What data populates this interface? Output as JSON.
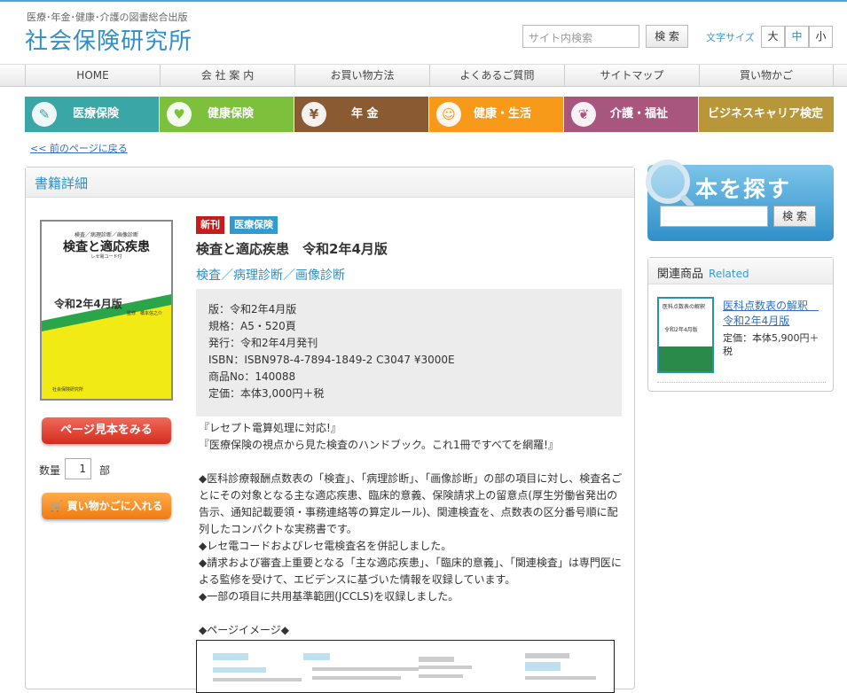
{
  "header": {
    "tagline": "医療･年金･健康･介護の図書総合出版",
    "logo": "社会保険研究所",
    "search_placeholder": "サイト内検索",
    "search_button": "検 索",
    "fontsize_label": "文字サイズ",
    "fontsize_options": [
      "大",
      "中",
      "小"
    ],
    "fontsize_selected": "中"
  },
  "nav": [
    "HOME",
    "会 社 案 内",
    "お買い物方法",
    "よくあるご質問",
    "サイトマップ",
    "買い物かご"
  ],
  "categories": [
    {
      "label": "医療保険",
      "icon": "syringe-icon",
      "glyph": "✎",
      "color": "#3aa6a6"
    },
    {
      "label": "健康保険",
      "icon": "heart-icon",
      "glyph": "♥",
      "color": "#7cc03c"
    },
    {
      "label": "年 金",
      "icon": "yen-icon",
      "glyph": "¥",
      "color": "#8a5a32"
    },
    {
      "label": "健康・生活",
      "icon": "running-icon",
      "glyph": "☺",
      "color": "#f79a1a"
    },
    {
      "label": "介護・福祉",
      "icon": "leaf-icon",
      "glyph": "❦",
      "color": "#a8567e"
    },
    {
      "label": "ビジネスキャリア検定",
      "icon": "",
      "glyph": "",
      "color": "#b8963a"
    }
  ],
  "back_link": "<< 前のページに戻る",
  "panel_title": "書籍詳細",
  "cover": {
    "subtitle": "検査／病理診断／画像診断",
    "title": "検査と適応疾患",
    "code": "レセ電コード付",
    "edition": "令和2年4月版",
    "editor": "監修　橋本信之介",
    "publisher": "社会保険研究所"
  },
  "buttons": {
    "page_preview": "ページ見本をみる",
    "add_cart": "買い物かごに入れる"
  },
  "quantity": {
    "label": "数量",
    "value": "1",
    "unit": "部"
  },
  "badges": {
    "new": "新刊",
    "category": "医療保険"
  },
  "book": {
    "title": "検査と適応疾患　令和2年4月版",
    "category_path": "検査／病理診断／画像診断",
    "specs": [
      "版：令和2年4月版",
      "規格：A5・520頁",
      "発行：令和2年4月発刊",
      "ISBN：ISBN978-4-7894-1849-2 C3047 ¥3000E",
      "商品No：140088",
      "定価：本体3,000円＋税"
    ],
    "description": [
      "『レセプト電算処理に対応!』",
      "『医療保険の視点から見た検査のハンドブック。これ1冊ですべてを網羅!』",
      "",
      "◆医科診療報酬点数表の「検査」、「病理診断」、「画像診断」の部の項目に対し、検査名ごとにその対象となる主な適応疾患、臨床的意義、保険請求上の留意点(厚生労働省発出の告示、通知記載要領・事務連絡等の算定ルール)、関連検査を、点数表の区分番号順に配列したコンパクトな実務書です。",
      "◆レセ電コードおよびレセ電検査名を併記しました。",
      "◆請求および審査上重要となる「主な適応疾患」、「臨床的意義」、「関連検査」は専門医による監修を受けて、エビデンスに基づいた情報を収録しています。",
      "◆一部の項目に共用基準範囲(JCCLS)を収録しました。",
      "",
      "◆ページイメージ◆"
    ]
  },
  "sidebar": {
    "search_title": "本を探す",
    "search_button": "検 索",
    "related_title": "関連商品",
    "related_en": "Related",
    "related_item": {
      "title": "医科点数表の解釈　令和2年4月版",
      "price": "定価：本体5,900円＋税",
      "cover_text": "医科点数表の解釈",
      "cover_edition": "令和2年4月版"
    }
  },
  "colors": {
    "accent": "#2f8fc8",
    "new_badge": "#cc1a1a",
    "category_badge": "#2f9bd0"
  }
}
